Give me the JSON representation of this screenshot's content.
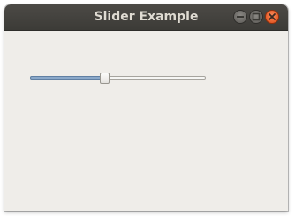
{
  "window": {
    "title": "Slider Example",
    "buttons": {
      "minimize": "minimize-icon",
      "maximize": "maximize-icon",
      "close": "close-icon"
    },
    "colors": {
      "titlebar": "#3c3b37",
      "background": "#efede9",
      "close_button": "#e95420",
      "slider_fill": "#8aa8c9"
    }
  },
  "slider": {
    "level": 0.42
  }
}
